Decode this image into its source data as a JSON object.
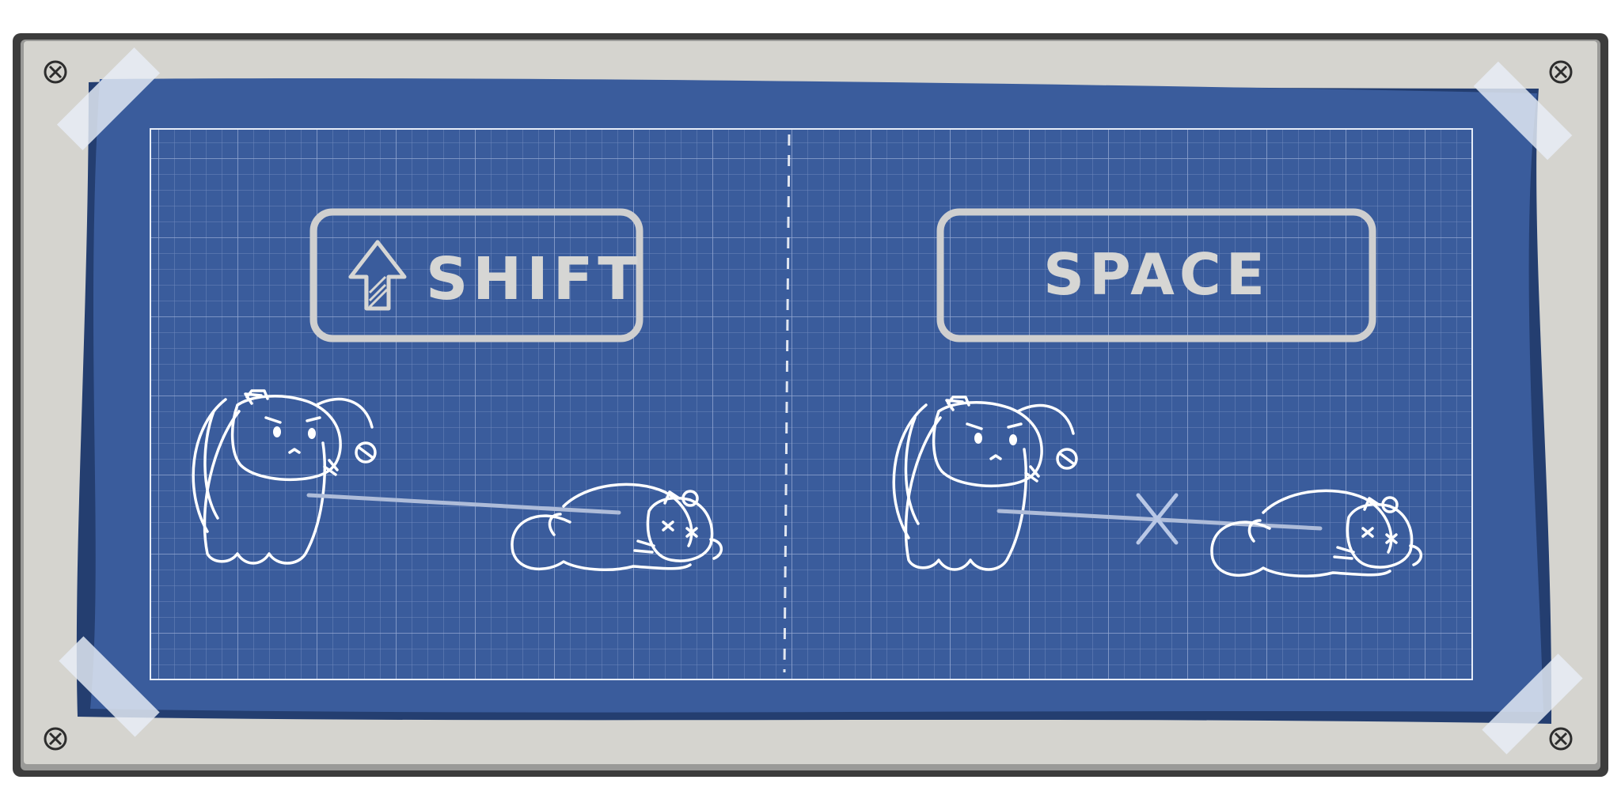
{
  "scene": "blueprint-controls-board",
  "colors": {
    "frame_outer": "#3c3c3c",
    "frame_inner": "#d5d4cf",
    "blueprint": "#3a5c9c",
    "blueprint_edge": "#243e70",
    "grid": "#7f97c8",
    "chalk": "#ffffff",
    "key_outline": "#cfcfcf",
    "tape": "#e8eef6"
  },
  "panels": [
    {
      "id": "shift",
      "key": {
        "label": "SHIFT",
        "icon": "shift-arrow-icon"
      },
      "action": "dash-through-enemy",
      "beam": "solid"
    },
    {
      "id": "space",
      "key": {
        "label": "SPACE",
        "icon": ""
      },
      "action": "blocked-attack",
      "beam": "crossed"
    }
  ]
}
